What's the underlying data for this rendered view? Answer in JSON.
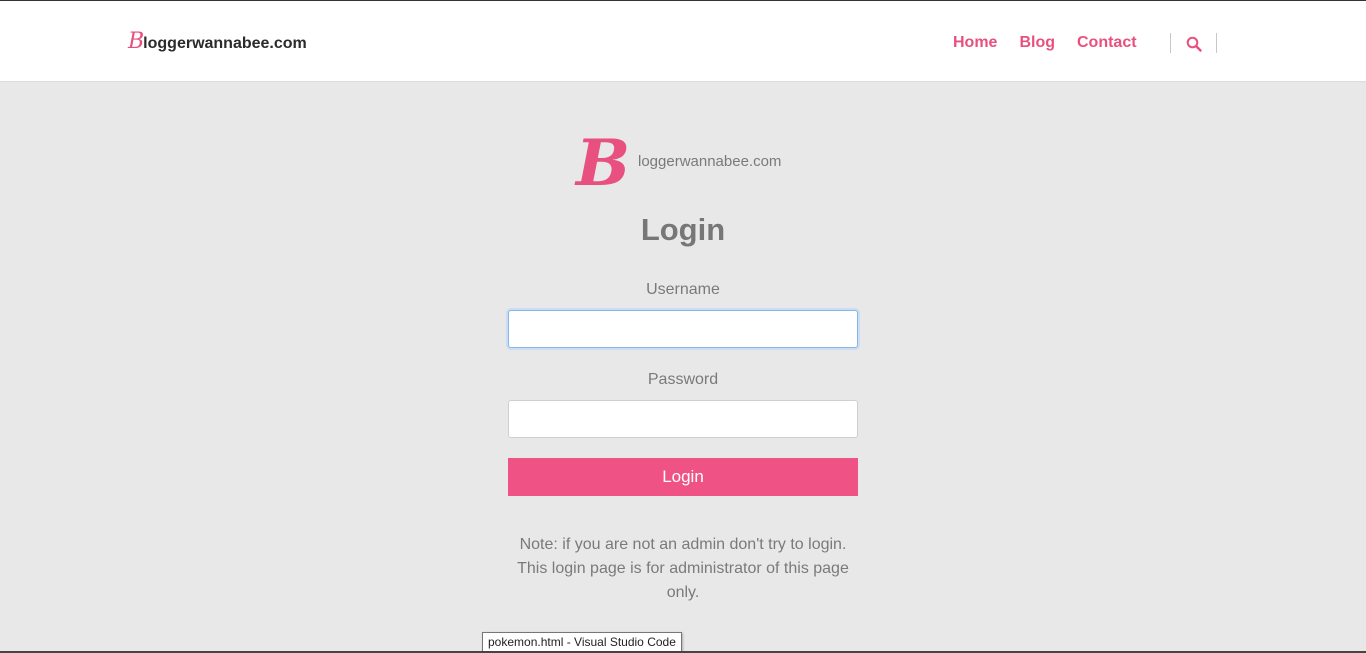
{
  "header": {
    "brand_initial": "B",
    "brand_rest": "loggerwannabee.com",
    "nav": [
      {
        "label": "Home"
      },
      {
        "label": "Blog"
      },
      {
        "label": "Contact"
      }
    ],
    "search_icon": "search-icon"
  },
  "logo": {
    "initial": "B",
    "rest": "loggerwannabee.com"
  },
  "login": {
    "title": "Login",
    "username_label": "Username",
    "username_value": "",
    "password_label": "Password",
    "password_value": "",
    "button_label": "Login",
    "note": "Note: if you are not an admin don't try to login. This login page is for administrator of this page only."
  },
  "tooltip": {
    "text": "pokemon.html - Visual Studio Code"
  },
  "colors": {
    "accent": "#ef5285",
    "background": "#e8e8e8",
    "header_bg": "#ffffff"
  }
}
